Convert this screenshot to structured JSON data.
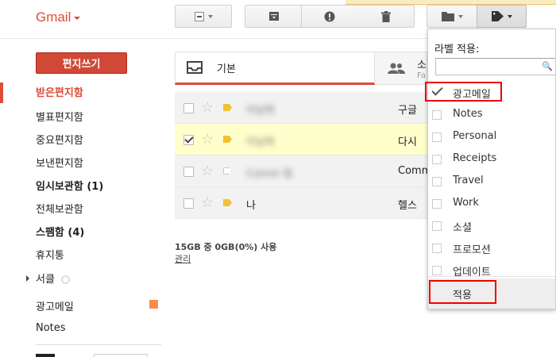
{
  "header": {
    "logo": "Gmail"
  },
  "sidebar": {
    "compose_label": "편지쓰기",
    "items": [
      {
        "label": "받은편지함",
        "style": "active"
      },
      {
        "label": "별표편지함",
        "style": "normal"
      },
      {
        "label": "중요편지함",
        "style": "normal"
      },
      {
        "label": "보낸편지함",
        "style": "normal"
      },
      {
        "label": "임시보관함 (1)",
        "style": "bold"
      },
      {
        "label": "전체보관함",
        "style": "normal"
      },
      {
        "label": "스팸함 (4)",
        "style": "bold"
      },
      {
        "label": "휴지통",
        "style": "normal"
      },
      {
        "label": "서클",
        "style": "normal"
      },
      {
        "label": "광고메일",
        "style": "normal"
      },
      {
        "label": "Notes",
        "style": "normal"
      }
    ],
    "label_color": "#fb8c4c"
  },
  "tabs": [
    {
      "label": "기본",
      "sub": ""
    },
    {
      "label": "소",
      "sub": "Fa"
    }
  ],
  "messages": [
    {
      "sender": "이남희",
      "subject": "구글 ",
      "checked": false,
      "important": true
    },
    {
      "sender": "이남희",
      "subject": "다시 ",
      "checked": true,
      "important": true
    },
    {
      "sender": "Comm 팀",
      "subject": "Comm",
      "checked": false,
      "important": false
    },
    {
      "sender": "나",
      "subject": "헬스 ",
      "checked": false,
      "important": true
    }
  ],
  "footer": {
    "storage": "15GB 중 0GB(0%) 사용",
    "manage": "관리"
  },
  "label_menu": {
    "title": "라벨 적용:",
    "search_value": "",
    "items": [
      {
        "label": "광고메일",
        "checked": true
      },
      {
        "label": "Notes",
        "checked": false
      },
      {
        "label": "Personal",
        "checked": false
      },
      {
        "label": "Receipts",
        "checked": false
      },
      {
        "label": "Travel",
        "checked": false
      },
      {
        "label": "Work",
        "checked": false
      },
      {
        "label": "소셜",
        "checked": false
      },
      {
        "label": "프로모션",
        "checked": false
      },
      {
        "label": "업데이트",
        "checked": false
      }
    ],
    "apply_label": "적용"
  },
  "colors": {
    "accent": "#dd4b39",
    "compose_bg": "#d14836",
    "selected_row": "#ffffcc",
    "highlight_box": "#ee0000"
  }
}
